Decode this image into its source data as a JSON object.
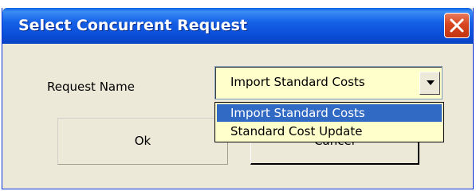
{
  "window": {
    "title": "Select Concurrent Request"
  },
  "form": {
    "request_name_label": "Request Name",
    "request_name_value": "Import Standard Costs",
    "options": [
      "Import Standard Costs",
      "Standard Cost Update"
    ],
    "selected_option_index": 0
  },
  "buttons": {
    "ok_label": "Ok",
    "cancel_label": "Cancel"
  },
  "colors": {
    "titlebar": "#0b4ed8",
    "close_button": "#d8461f",
    "dialog_background": "#ece9d8",
    "field_background": "#ffffcc",
    "highlight": "#316ac5"
  },
  "icons": {
    "close": "close-icon",
    "dropdown_arrow": "chevron-down-icon"
  }
}
